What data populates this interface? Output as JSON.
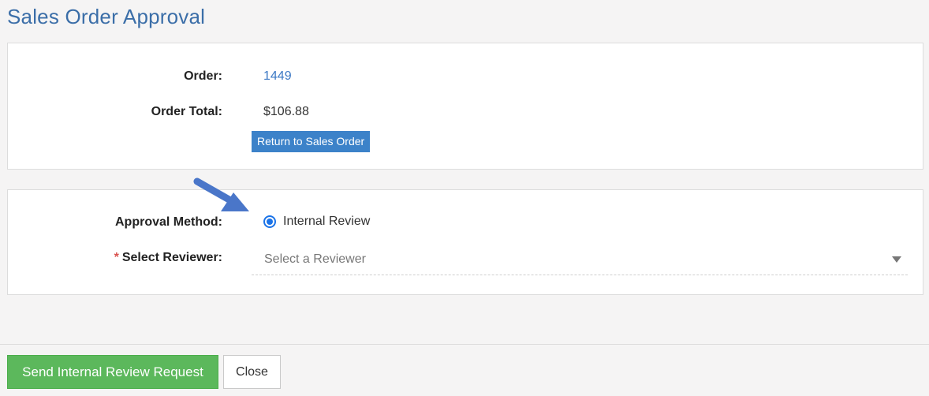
{
  "page": {
    "title": "Sales Order Approval"
  },
  "order": {
    "order_label": "Order:",
    "order_number": "1449",
    "total_label": "Order Total:",
    "total_value": "$106.88",
    "return_button": "Return to Sales Order"
  },
  "approval": {
    "method_label": "Approval Method:",
    "method_option": "Internal Review",
    "method_selected": true,
    "required_marker": "*",
    "reviewer_label": "Select Reviewer:",
    "reviewer_placeholder": "Select a Reviewer"
  },
  "footer": {
    "send_button": "Send Internal Review Request",
    "close_button": "Close"
  },
  "colors": {
    "title": "#3b6ea8",
    "link": "#3b78c4",
    "primary_button": "#3c82c9",
    "success_button": "#5cb85c",
    "radio": "#1a73e8",
    "annotation_arrow": "#4a76c9"
  },
  "icons": {
    "annotation": "arrow-icon",
    "dropdown": "chevron-down-icon"
  }
}
